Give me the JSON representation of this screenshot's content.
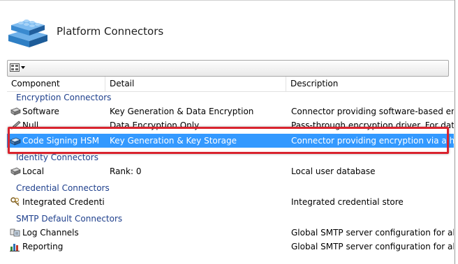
{
  "header": {
    "title": "Platform Connectors"
  },
  "columns": {
    "component": "Component",
    "detail": "Detail",
    "description": "Description"
  },
  "groups": {
    "encryption": {
      "label": "Encryption Connectors",
      "rows": [
        {
          "component": "Software",
          "detail": "Key Generation & Data Encryption",
          "description": "Connector providing software-based encry",
          "icon": "disk-drive-icon"
        },
        {
          "component": "Null",
          "detail": "Data Encryption Only",
          "description": "Pass-through encryption driver. For data th",
          "icon": "pencil-icon"
        },
        {
          "component": "Code Signing HSM",
          "detail": "Key Generation & Key Storage",
          "description": "Connector providing encryption via a hard",
          "icon": "hsm-device-icon",
          "selected": true
        }
      ]
    },
    "identity": {
      "label": "Identity Connectors",
      "rows": [
        {
          "component": "Local",
          "detail": "Rank: 0",
          "description": "Local user database",
          "icon": "disk-drive-icon"
        }
      ]
    },
    "credential": {
      "label": "Credential Connectors",
      "rows": [
        {
          "component": "Integrated Credentials",
          "detail": "",
          "description": "Integrated credential store",
          "icon": "keys-icon"
        }
      ]
    },
    "smtp": {
      "label": "SMTP Default Connectors",
      "rows": [
        {
          "component": "Log Channels",
          "detail": "",
          "description": "Global SMTP server configuration for all SM",
          "icon": "log-channels-icon"
        },
        {
          "component": "Reporting",
          "detail": "",
          "description": "Global SMTP server configuration for all Re",
          "icon": "bar-chart-icon"
        }
      ]
    }
  },
  "colors": {
    "selection": "#3399ff",
    "group_text": "#1e3f8c",
    "highlight_box": "#d9232e",
    "logo_blue": "#2f7fc4"
  }
}
